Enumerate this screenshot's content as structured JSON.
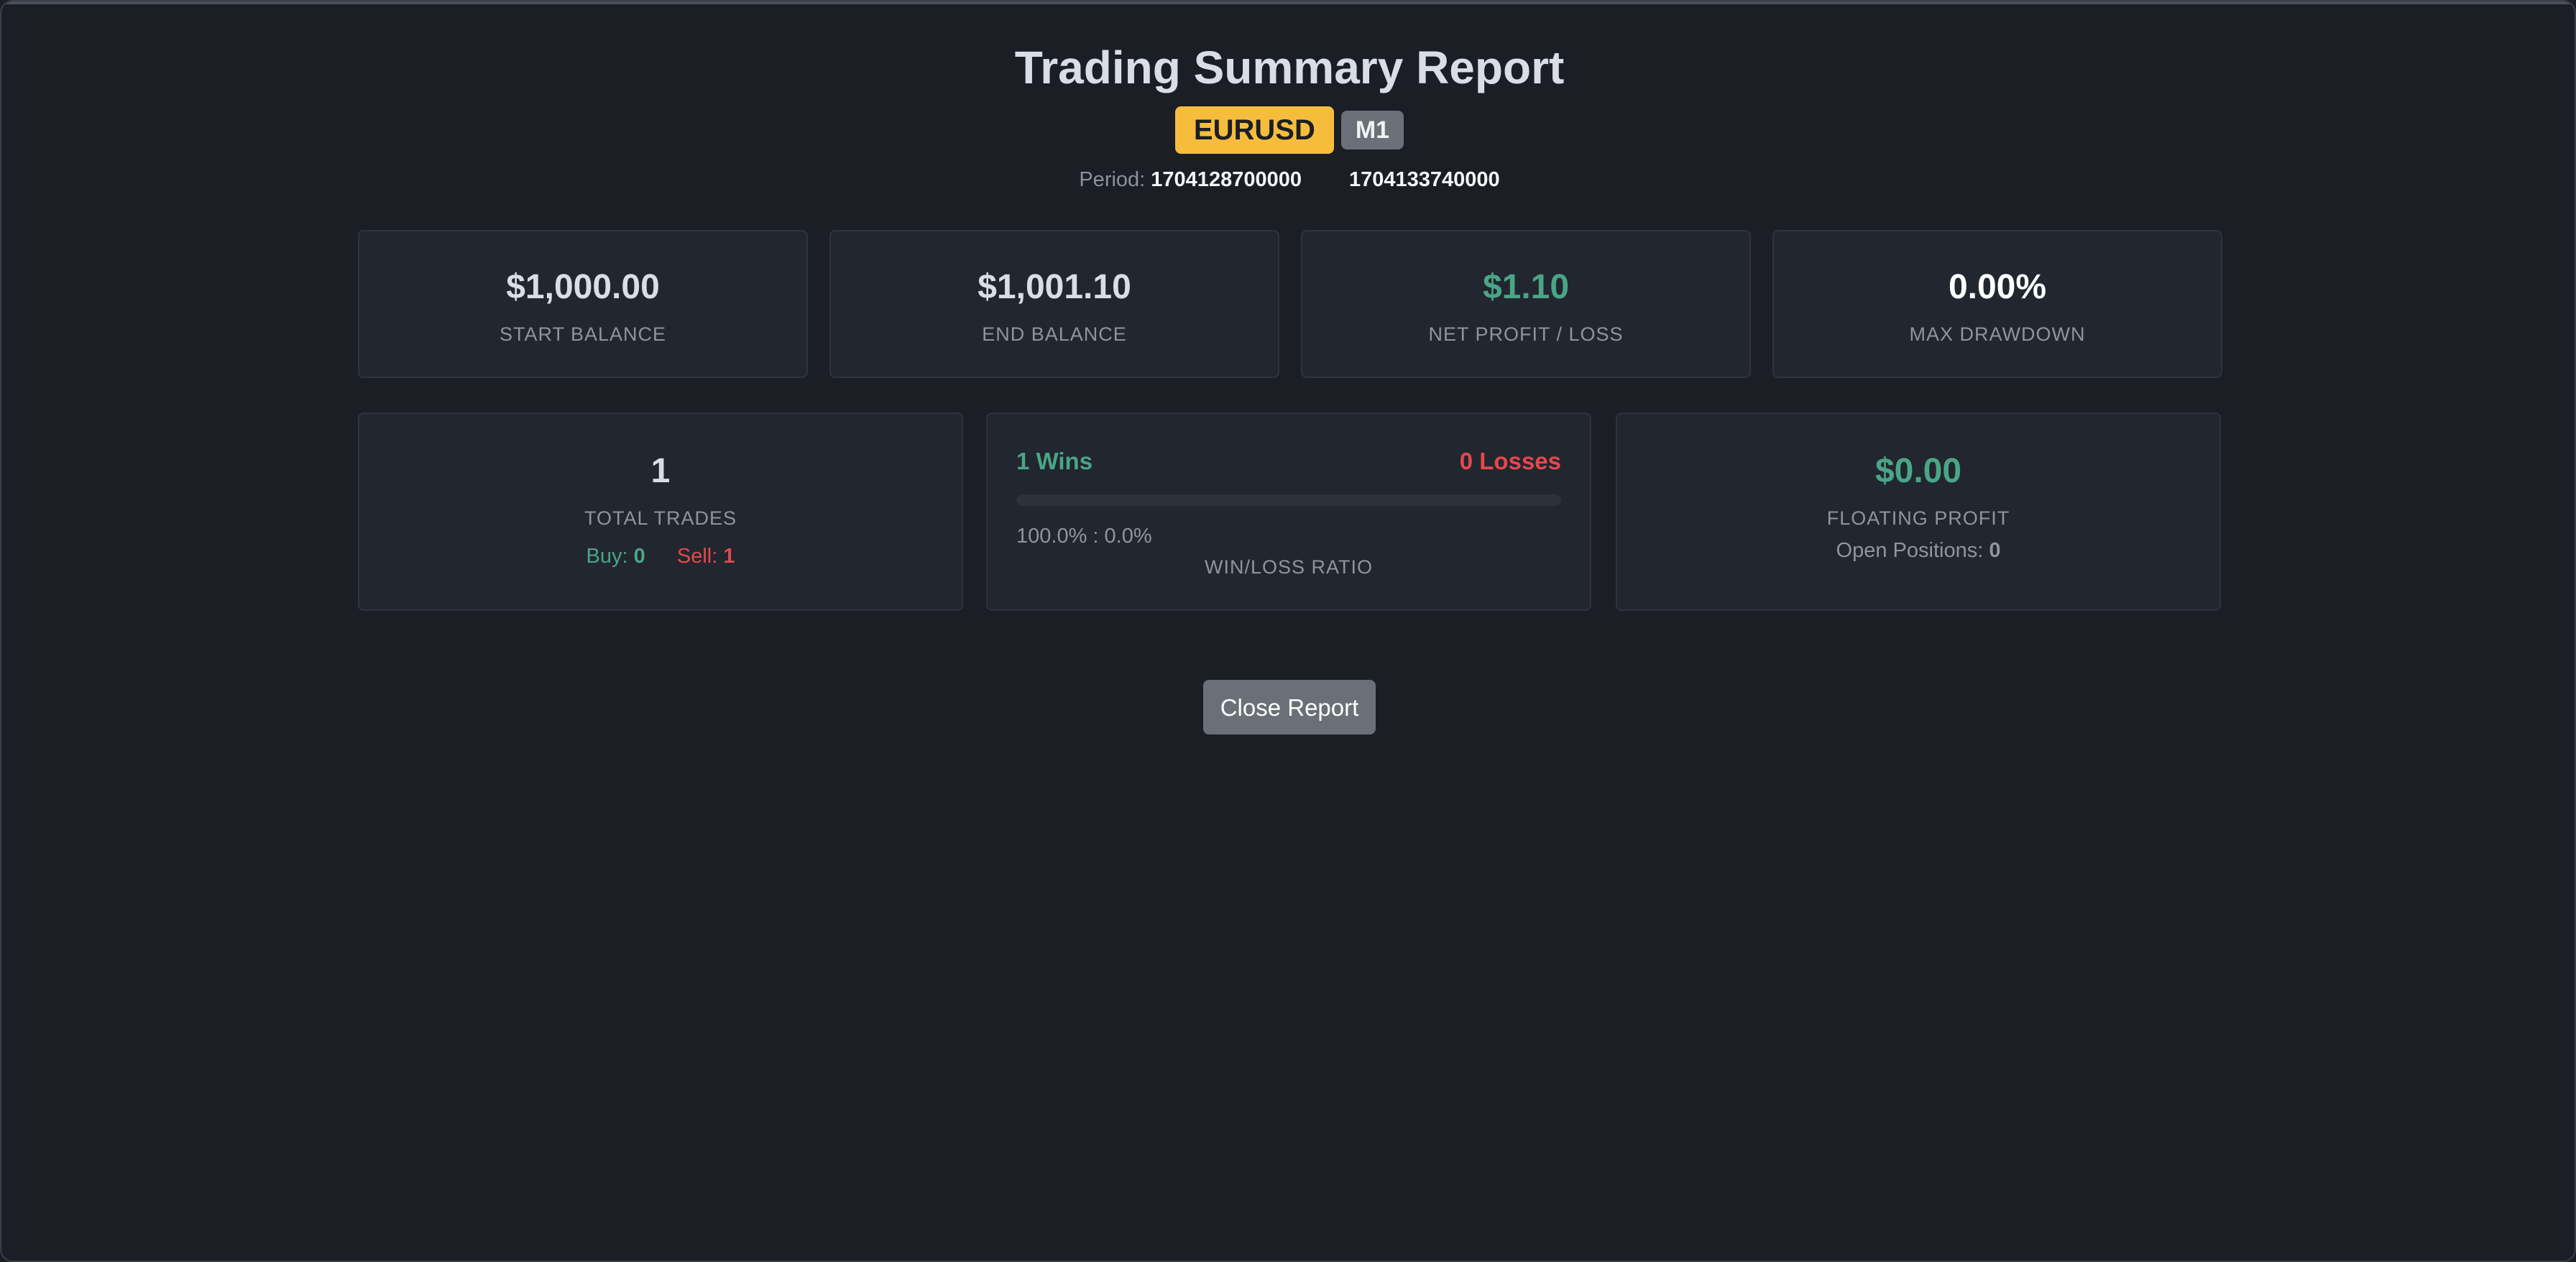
{
  "report": {
    "title": "Trading Summary Report",
    "symbol": "EURUSD",
    "timeframe": "M1",
    "period_label": "Period:",
    "period_start": "1704128700000",
    "period_end": "1704133740000"
  },
  "stats": {
    "start_balance": {
      "value": "$1,000.00",
      "label": "START BALANCE"
    },
    "end_balance": {
      "value": "$1,001.10",
      "label": "END BALANCE"
    },
    "net_profit": {
      "value": "$1.10",
      "label": "NET PROFIT / LOSS"
    },
    "max_drawdown": {
      "value": "0.00%",
      "label": "MAX DRAWDOWN"
    }
  },
  "trades": {
    "total": "1",
    "label": "TOTAL TRADES",
    "buy_label": "Buy:",
    "buy_count": "0",
    "sell_label": "Sell:",
    "sell_count": "1"
  },
  "winloss": {
    "wins_text": "1 Wins",
    "losses_text": "0 Losses",
    "ratio_text": "100.0% : 0.0%",
    "label": "WIN/LOSS RATIO",
    "win_fraction": 1.0
  },
  "floating": {
    "value": "$0.00",
    "label": "FLOATING PROFIT",
    "open_positions_label": "Open Positions:",
    "open_positions": "0"
  },
  "actions": {
    "close_label": "Close Report"
  },
  "colors": {
    "background": "#1b1e25",
    "card": "#22262e",
    "profit_green": "#4aa587",
    "loss_red": "#e5484d",
    "symbol_badge": "#f6bd3c",
    "button_gray": "#6b7078"
  }
}
